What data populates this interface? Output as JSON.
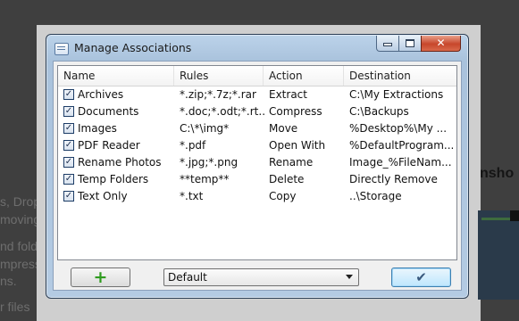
{
  "background": {
    "fragments": [
      "s, Drop",
      "moving",
      "nd fold",
      "mpress",
      "ns.",
      "r files"
    ],
    "heading": "nsho"
  },
  "window": {
    "title": "Manage Associations",
    "icon": "app-window-icon"
  },
  "list": {
    "columns": [
      "Name",
      "Rules",
      "Action",
      "Destination"
    ],
    "rows": [
      {
        "checked": true,
        "name": "Archives",
        "rules": "*.zip;*.7z;*.rar",
        "action": "Extract",
        "destination": "C:\\My Extractions"
      },
      {
        "checked": true,
        "name": "Documents",
        "rules": "*.doc;*.odt;*.rt...",
        "action": "Compress",
        "destination": "C:\\Backups"
      },
      {
        "checked": true,
        "name": "Images",
        "rules": "C:\\*\\img*",
        "action": "Move",
        "destination": "%Desktop%\\My ..."
      },
      {
        "checked": true,
        "name": "PDF Reader",
        "rules": "*.pdf",
        "action": "Open With",
        "destination": "%DefaultProgram..."
      },
      {
        "checked": true,
        "name": "Rename Photos",
        "rules": "*.jpg;*.png",
        "action": "Rename",
        "destination": "Image_%FileNam..."
      },
      {
        "checked": true,
        "name": "Temp Folders",
        "rules": "**temp**",
        "action": "Delete",
        "destination": "Directly Remove"
      },
      {
        "checked": true,
        "name": "Text Only",
        "rules": "*.txt",
        "action": "Copy",
        "destination": "..\\Storage"
      }
    ]
  },
  "footer": {
    "add_icon": "plus-icon",
    "profile_selected": "Default",
    "ok_icon": "checkmark-icon"
  },
  "colors": {
    "plus": "#2e9b1e",
    "close_button": "#c7462b",
    "ok_button": "#bee6fd"
  }
}
